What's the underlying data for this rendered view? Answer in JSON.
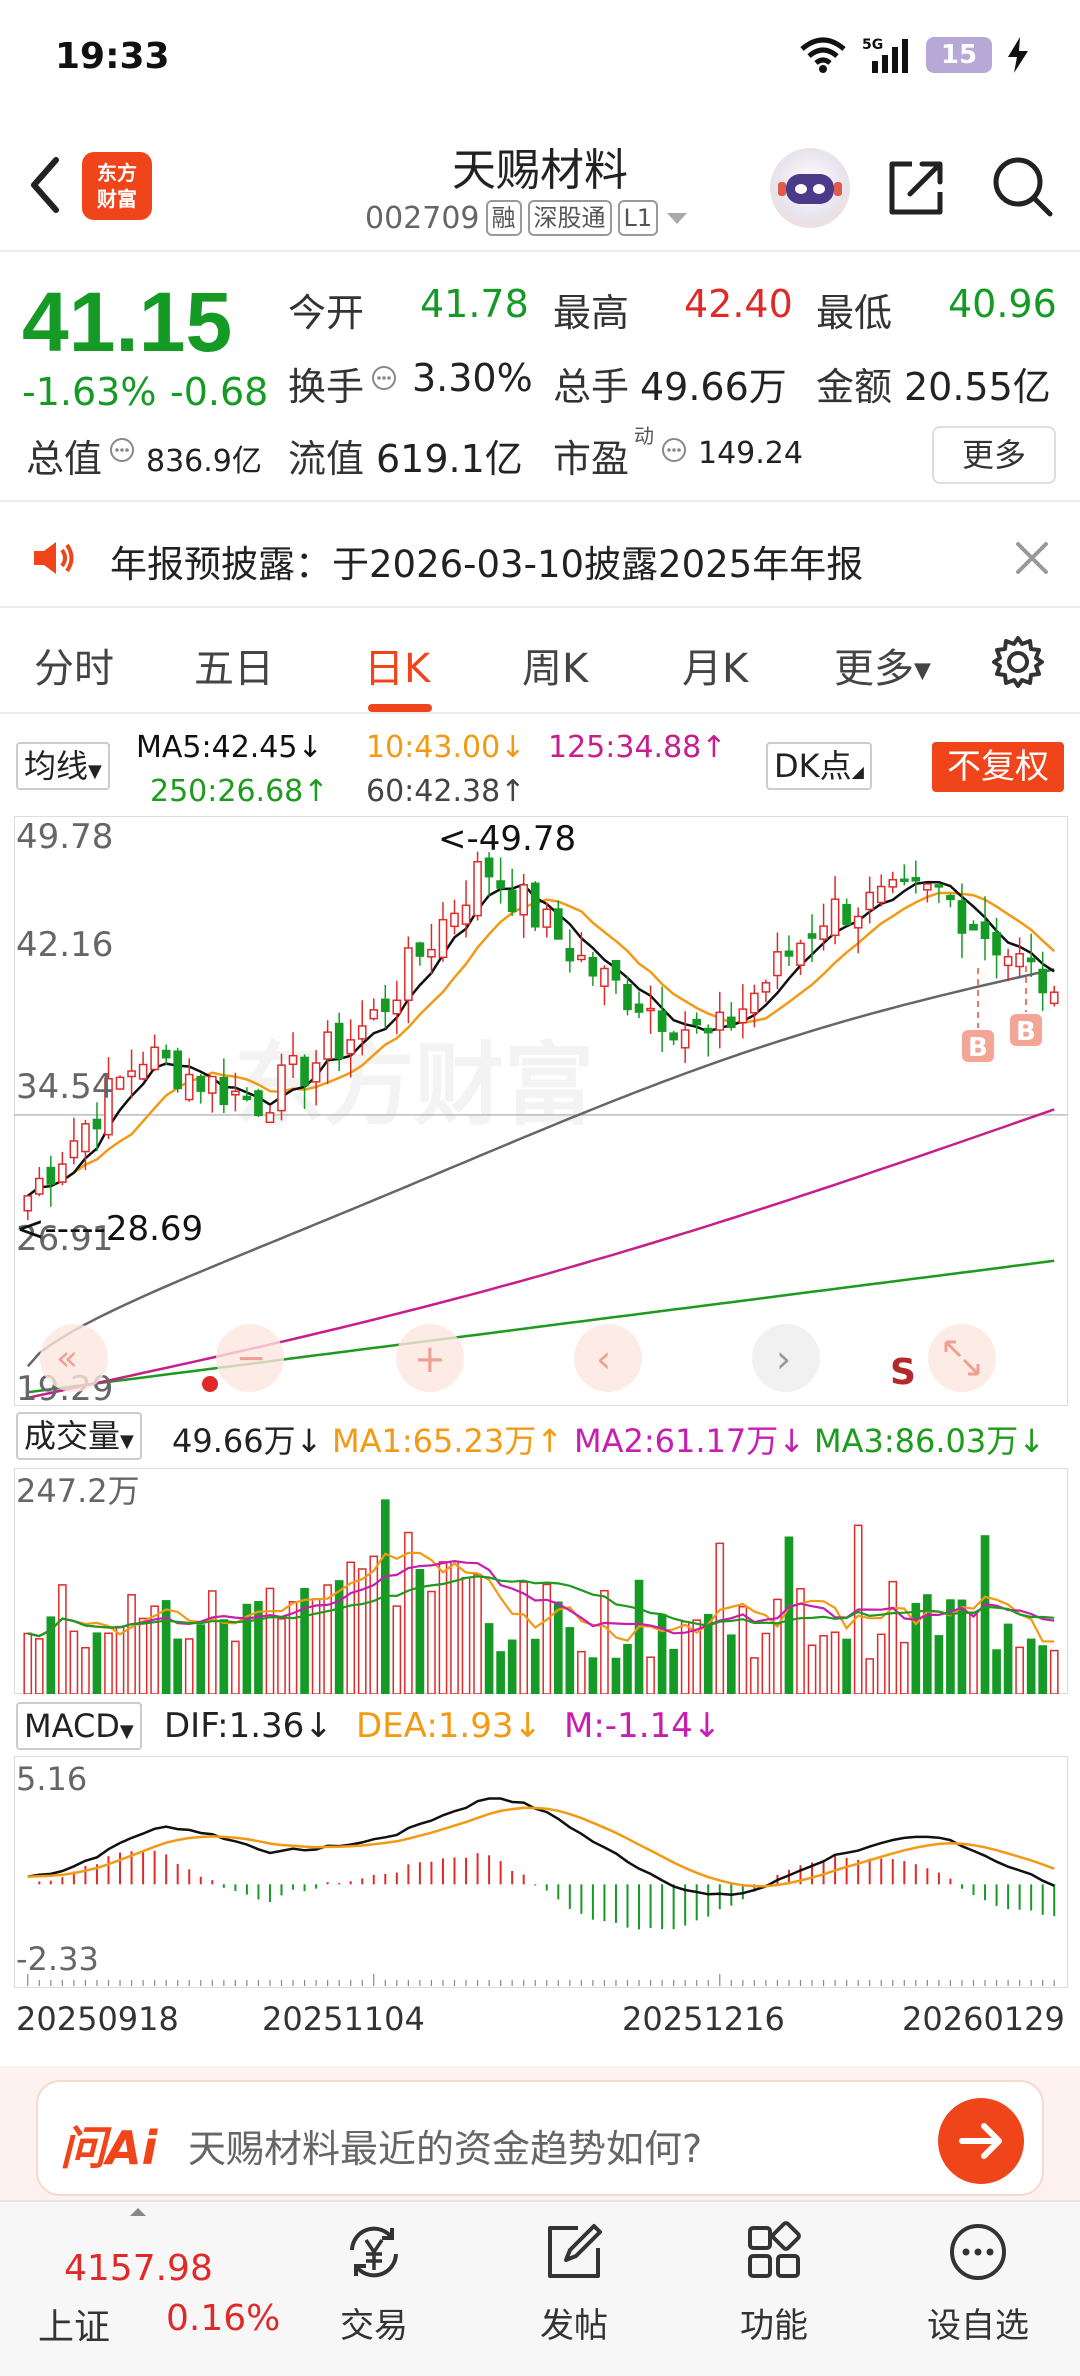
{
  "status_bar": {
    "time": "19:33",
    "battery": "15"
  },
  "header": {
    "logo_line1": "东方",
    "logo_line2": "财富",
    "stock_name": "天赐材料",
    "stock_code": "002709",
    "tags": [
      "融",
      "深股通",
      "L1"
    ]
  },
  "quote": {
    "price": "41.15",
    "change_pct": "-1.63%",
    "change": "-0.68",
    "fields": {
      "open_label": "今开",
      "open": "41.78",
      "high_label": "最高",
      "high": "42.40",
      "low_label": "最低",
      "low": "40.96",
      "turnover_label": "换手",
      "turnover": "3.30%",
      "volume_label": "总手",
      "volume": "49.66万",
      "amount_label": "金额",
      "amount": "20.55亿",
      "mktcap_label": "总值",
      "mktcap": "836.9亿",
      "float_label": "流值",
      "float": "619.1亿",
      "pe_label": "市盈",
      "pe_super": "动",
      "pe": "149.24"
    },
    "more_label": "更多"
  },
  "notice": {
    "text": "年报预披露：于2026-03-10披露2025年年报"
  },
  "tabs": [
    "分时",
    "五日",
    "日K",
    "周K",
    "月K",
    "更多"
  ],
  "active_tab": "日K",
  "ma_legend": {
    "selector": "均线",
    "ma5": "MA5:42.45↓",
    "ma10": "10:43.00↓",
    "ma125": "125:34.88↑",
    "ma250": "250:26.68↑",
    "ma60": "60:42.38↑",
    "dk": "DK点",
    "fuquan": "不复权"
  },
  "colors": {
    "up": "#e02a2a",
    "down": "#169a26",
    "accent": "#f0441a",
    "ma5": "#111111",
    "ma10": "#f29a14",
    "ma60": "#666666",
    "ma125": "#c81e8c",
    "ma250": "#1e9a1e"
  },
  "chart_data": [
    {
      "type": "candlestick",
      "title": "",
      "y_ticks": [
        "49.78",
        "42.16",
        "34.54",
        "26.91",
        "19.29"
      ],
      "ylim": [
        19.29,
        49.78
      ],
      "max_label": "<-49.78",
      "min_label": "<-----28.69",
      "markers": [
        "B",
        "B"
      ],
      "x_ticks": [
        "20250918",
        "20251104",
        "20251216",
        "20260129"
      ],
      "close_key_points": [
        {
          "date": "20250918",
          "value": 30.2
        },
        {
          "date": "20251010",
          "value": 37.8
        },
        {
          "date": "20251020",
          "value": 35.2
        },
        {
          "date": "20251104",
          "value": 39.5
        },
        {
          "date": "20251118",
          "value": 48.0
        },
        {
          "date": "20251128",
          "value": 42.0
        },
        {
          "date": "20251216",
          "value": 38.5
        },
        {
          "date": "20260105",
          "value": 45.5
        },
        {
          "date": "20260115",
          "value": 46.5
        },
        {
          "date": "20260129",
          "value": 41.15
        }
      ],
      "series": [
        {
          "name": "MA5",
          "end_value": 42.45
        },
        {
          "name": "MA10",
          "end_value": 43.0
        },
        {
          "name": "MA60",
          "end_value": 42.38
        },
        {
          "name": "MA125",
          "end_value": 34.88
        },
        {
          "name": "MA250",
          "end_value": 26.68
        }
      ]
    },
    {
      "type": "bar",
      "title": "成交量",
      "legend": {
        "selector": "成交量",
        "current": "49.66万↓",
        "ma1": "MA1:65.23万↑",
        "ma2": "MA2:61.17万↓",
        "ma3": "MA3:86.03万↓"
      },
      "y_max_label": "247.2万",
      "ylim": [
        0,
        247.2
      ],
      "unit": "万"
    },
    {
      "type": "line",
      "title": "MACD",
      "legend": {
        "selector": "MACD",
        "dif": "DIF:1.36↓",
        "dea": "DEA:1.93↓",
        "m": "M:-1.14↓"
      },
      "y_ticks": [
        "5.16",
        "-2.33"
      ],
      "ylim": [
        -2.33,
        5.16
      ]
    }
  ],
  "ai": {
    "logo": "问Ai",
    "question": "天赐材料最近的资金趋势如何?"
  },
  "bottom_nav": {
    "index_value": "4157.98",
    "index_name": "上证",
    "index_pct": "0.16%",
    "items": [
      "交易",
      "发帖",
      "功能",
      "设自选"
    ]
  }
}
